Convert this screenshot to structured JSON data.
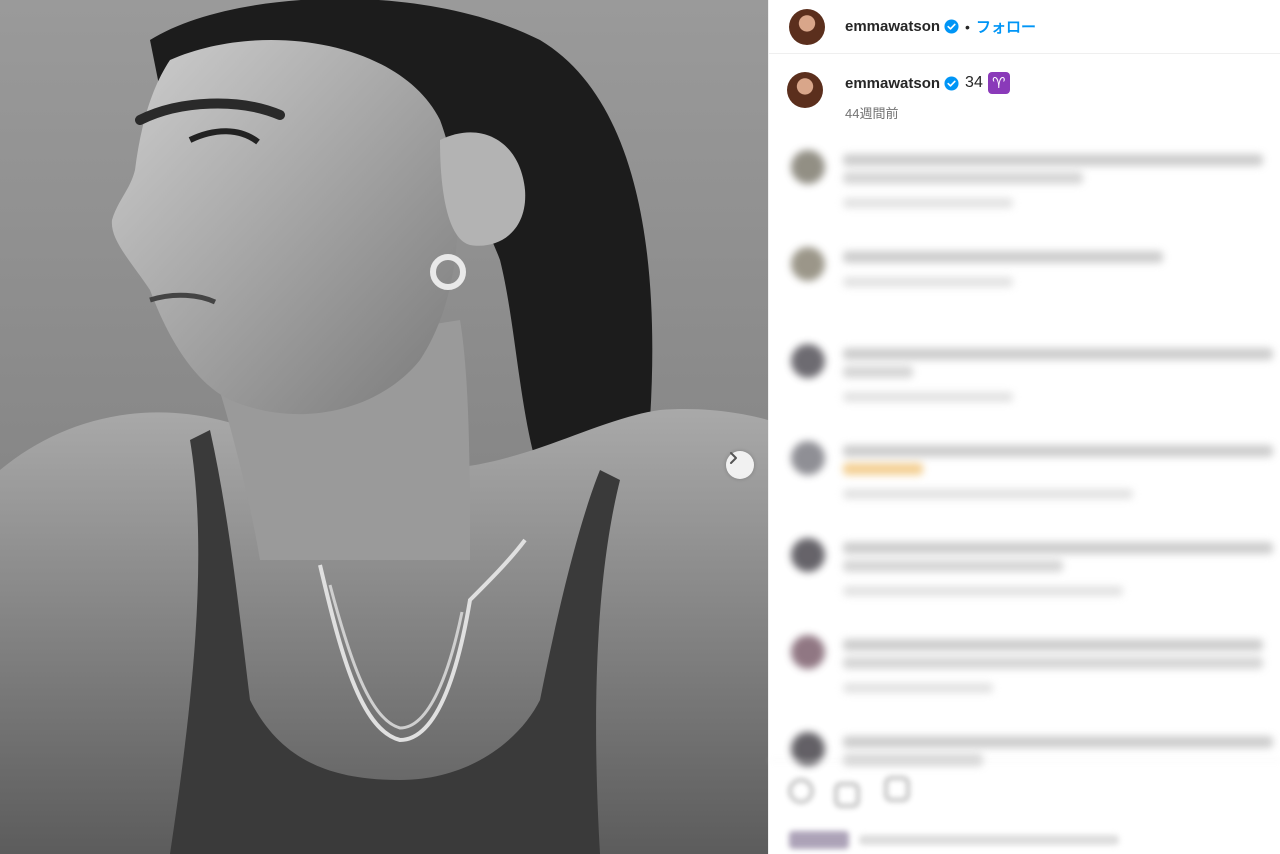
{
  "header": {
    "username": "emmawatson",
    "separator": "•",
    "follow_label": "フォロー"
  },
  "caption": {
    "username": "emmawatson",
    "text": "34",
    "emoji": "♈",
    "time_ago": "44週間前"
  },
  "photo": {
    "description_icon": "portrait-photo",
    "next_icon": "chevron-right-icon"
  },
  "colors": {
    "accent": "#0095f6",
    "verified": "#0095f6",
    "aries_bg": "#8a3ab9"
  }
}
